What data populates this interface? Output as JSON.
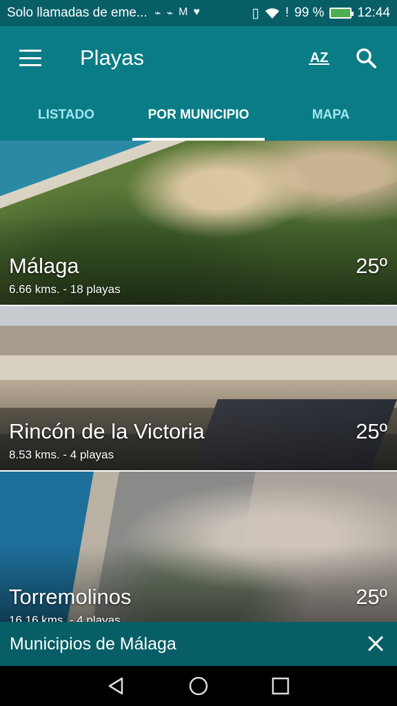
{
  "status_bar": {
    "notification_text": "Solo llamadas de eme...",
    "notification_icons": [
      "usb-icon",
      "usb-icon",
      "gmail-icon",
      "heart-icon"
    ],
    "battery_percent": "99 %",
    "battery_level": 0.99,
    "time": "12:44"
  },
  "app_bar": {
    "title": "Playas",
    "sort_icon_label": "AZ"
  },
  "tabs": [
    {
      "label": "LISTADO",
      "active": false
    },
    {
      "label": "POR MUNICIPIO",
      "active": true
    },
    {
      "label": "MAPA",
      "active": false
    }
  ],
  "municipalities": [
    {
      "name": "Málaga",
      "detail": "6.66 kms. - 18 playas",
      "temp": "25º"
    },
    {
      "name": "Rincón de la Victoria",
      "detail": "8.53 kms. - 4 playas",
      "temp": "25º"
    },
    {
      "name": "Torremolinos",
      "detail": "16.16 kms. - 4 playas",
      "temp": "25º"
    }
  ],
  "bottom_sheet": {
    "label": "Municipios de Málaga"
  },
  "colors": {
    "primary": "#0A7C86",
    "primary_dark": "#075E66",
    "tab_inactive": "#9FE6F0"
  }
}
